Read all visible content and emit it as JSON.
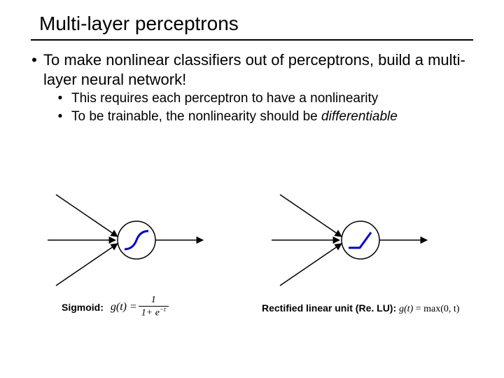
{
  "title": "Multi-layer perceptrons",
  "bullets": {
    "l1": "To make nonlinear classifiers out of perceptrons, build a multi-layer neural network!",
    "l2a": "This requires each perceptron to have a nonlinearity",
    "l2b_prefix": "To be trainable, the nonlinearity should be ",
    "l2b_ital": "differentiable"
  },
  "sigmoid": {
    "label": "Sigmoid:",
    "lhs": "g(t) =",
    "num": "1",
    "den_prefix": "1+ e",
    "den_exp": "−t"
  },
  "relu": {
    "label": "Rectified linear unit (Re. LU):",
    "formula_lhs": "g(t)",
    "formula_eq": " = ",
    "formula_rhs": "max(0, t)"
  }
}
